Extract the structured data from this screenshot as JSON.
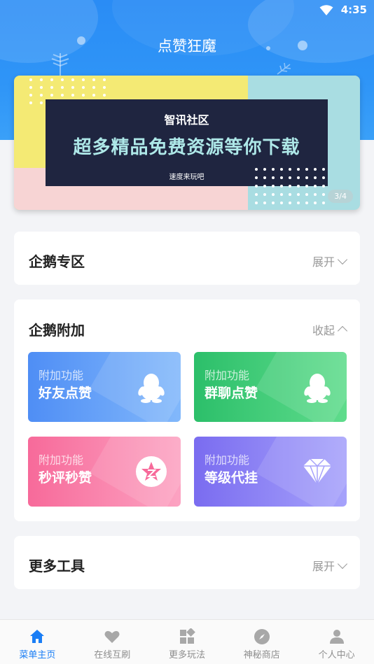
{
  "status_bar": {
    "time": "4:35"
  },
  "app": {
    "title": "点赞狂魔"
  },
  "banner": {
    "brand": "智讯社区",
    "headline": "超多精品免费资源等你下载",
    "sub": "速度来玩吧",
    "page": "3/4"
  },
  "sections": [
    {
      "title": "企鹅专区",
      "toggle": "展开"
    },
    {
      "title": "企鹅附加",
      "toggle": "收起"
    },
    {
      "title": "更多工具",
      "toggle": "展开"
    }
  ],
  "features": [
    {
      "small": "附加功能",
      "label": "好友点赞",
      "icon": "penguin-icon",
      "color_from": "#4f8ef5",
      "color_to": "#82b8fb"
    },
    {
      "small": "附加功能",
      "label": "群聊点赞",
      "icon": "penguin-icon",
      "color_from": "#2cbf6a",
      "color_to": "#5fdc8c"
    },
    {
      "small": "附加功能",
      "label": "秒评秒赞",
      "icon": "star-badge-icon",
      "color_from": "#f76a9a",
      "color_to": "#fca3c2"
    },
    {
      "small": "附加功能",
      "label": "等级代挂",
      "icon": "diamond-icon",
      "color_from": "#7a6cf0",
      "color_to": "#a6a2fb"
    }
  ],
  "tabs": [
    {
      "label": "菜单主页",
      "icon": "home-icon",
      "active": true
    },
    {
      "label": "在线互刷",
      "icon": "heart-icon",
      "active": false
    },
    {
      "label": "更多玩法",
      "icon": "grid-icon",
      "active": false
    },
    {
      "label": "神秘商店",
      "icon": "compass-icon",
      "active": false
    },
    {
      "label": "个人中心",
      "icon": "person-icon",
      "active": false
    }
  ],
  "colors": {
    "accent": "#1a7ef5",
    "header": "#2f95f7"
  }
}
